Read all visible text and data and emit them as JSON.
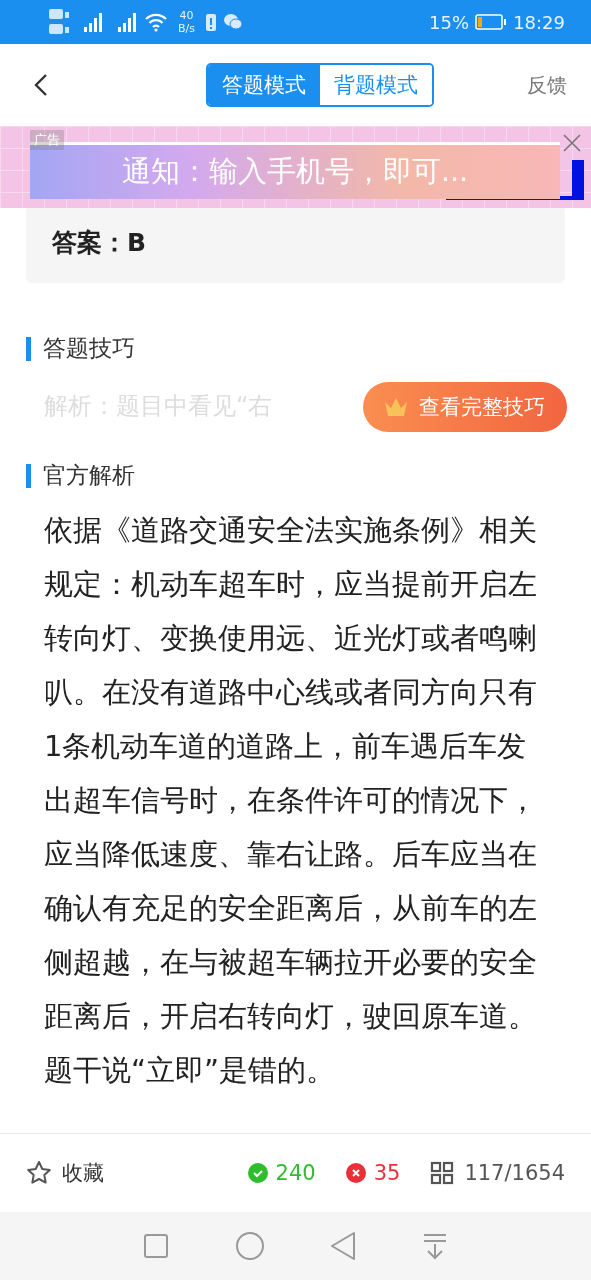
{
  "status_bar": {
    "net_speed_value": "40",
    "net_speed_unit": "B/s",
    "battery": "15%",
    "time": "18:29"
  },
  "header": {
    "tabs": [
      {
        "label": "答题模式",
        "selected": true
      },
      {
        "label": "背题模式",
        "selected": false
      }
    ],
    "feedback": "反馈"
  },
  "ad": {
    "tag": "广告",
    "text": "通知：输入手机号，即可..."
  },
  "answer": {
    "text": "答案：B"
  },
  "sections": [
    {
      "title": "答题技巧",
      "kind": "tip",
      "text": "解析：题目中看见“右",
      "button": "查看完整技巧"
    },
    {
      "title": "官方解析",
      "kind": "paragraph",
      "text": "依据《道路交通安全法实施条例》相关规定：机动车超车时，应当提前开启左转向灯、变换使用远、近光灯或者鸣喇叭。在没有道路中心线或者同方向只有1条机动车道的道路上，前车遇后车发出超车信号时，在条件许可的情况下，应当降低速度、靠右让路。后车应当在确认有充足的安全距离后，从前车的左侧超越，在与被超车辆拉开必要的安全距离后，开启右转向灯，驶回原车道。题干说“立即”是错的。"
    }
  ],
  "bottom_bar": {
    "favorite": "收藏",
    "correct": "240",
    "wrong": "35",
    "progress": "117/1654"
  }
}
